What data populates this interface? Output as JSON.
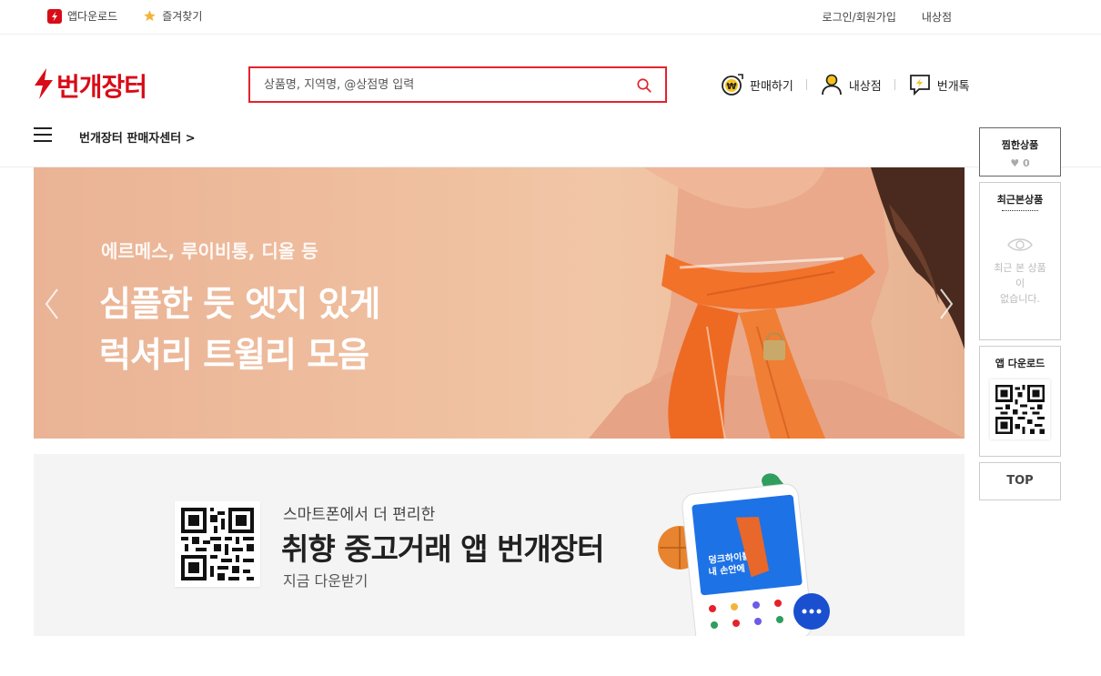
{
  "topbar": {
    "app_download": "앱다운로드",
    "bookmark": "즐겨찾기",
    "login": "로그인/회원가입",
    "my_shop": "내상점"
  },
  "header": {
    "logo_text": "번개장터",
    "search_placeholder": "상품명, 지역명, @상점명 입력",
    "sell": "판매하기",
    "my_shop": "내상점",
    "talk": "번개톡"
  },
  "category": {
    "seller_center": "번개장터 판매자센터 >"
  },
  "banner": {
    "subtitle": "에르메스, 루이비통, 디올 등",
    "title_line1": "심플한 듯 엣지 있게",
    "title_line2": "럭셔리 트윌리 모음"
  },
  "app_banner": {
    "line1": "스마트폰에서 더 편리한",
    "line2": "취향 중고거래 앱 번개장터",
    "line3": "지금 다운받기"
  },
  "side": {
    "wish_title": "찜한상품",
    "wish_count": "0",
    "recent_title": "최근본상품",
    "recent_empty_1": "최근 본 상품",
    "recent_empty_2": "이",
    "recent_empty_3": "없습니다.",
    "app_title": "앱 다운로드",
    "top": "TOP"
  },
  "icons": {
    "app": "lightning-app-icon",
    "bookmark": "star-icon",
    "logo": "lightning-logo-icon",
    "search": "search-icon",
    "sell": "won-coin-icon",
    "myshop": "person-icon",
    "talk": "chat-bolt-icon",
    "menu": "hamburger-icon"
  },
  "colors": {
    "brand": "#d80c18",
    "search_border": "#e4222c",
    "bookmark_star": "#f2b53b"
  }
}
